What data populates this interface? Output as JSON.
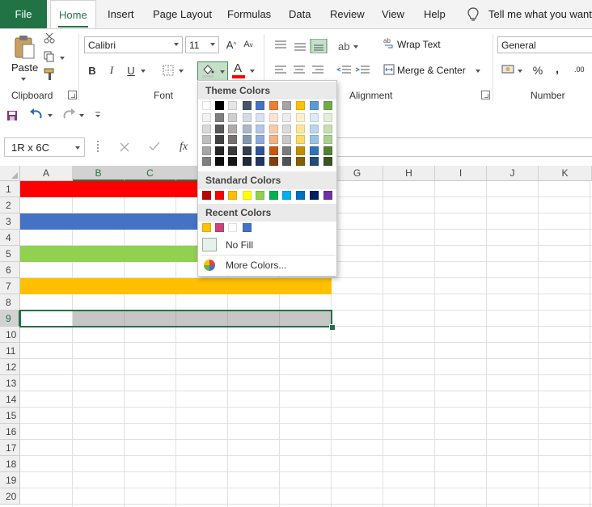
{
  "tabs": {
    "file": "File",
    "items": [
      "Home",
      "Insert",
      "Page Layout",
      "Formulas",
      "Data",
      "Review",
      "View",
      "Help"
    ],
    "tell_me": "Tell me what you want to do"
  },
  "clipboard": {
    "paste": "Paste",
    "label": "Clipboard"
  },
  "font": {
    "name": "Calibri",
    "size": "11",
    "label": "Font",
    "bold": "B",
    "italic": "I",
    "underline": "U"
  },
  "alignment": {
    "wrap": "Wrap Text",
    "merge": "Merge & Center",
    "label": "Alignment"
  },
  "number": {
    "format": "General",
    "label": "Number",
    "percent": "%",
    "comma": ",",
    "decimal": ".00"
  },
  "formula_bar": {
    "name_box": "1R x 6C",
    "fx": "fx",
    "value": ""
  },
  "columns": [
    "A",
    "B",
    "C",
    "D",
    "E",
    "F",
    "G",
    "H",
    "I",
    "J",
    "K"
  ],
  "rows": [
    "1",
    "2",
    "3",
    "4",
    "5",
    "6",
    "7",
    "8",
    "9",
    "10",
    "11",
    "12",
    "13",
    "14",
    "15",
    "16",
    "17",
    "18",
    "19",
    "20"
  ],
  "row_fills": [
    {
      "row": 1,
      "color": "#ff0000"
    },
    {
      "row": 3,
      "color": "#4472c4"
    },
    {
      "row": 5,
      "color": "#92d050"
    },
    {
      "row": 7,
      "color": "#ffc000"
    }
  ],
  "selection_fill": "#c6c6c6",
  "dropdown": {
    "theme_title": "Theme Colors",
    "standard_title": "Standard Colors",
    "recent_title": "Recent Colors",
    "no_fill": "No Fill",
    "more_colors": "More Colors...",
    "theme_colors": [
      [
        "#ffffff",
        "#f2f2f2",
        "#d9d9d9",
        "#bfbfbf",
        "#a6a6a6",
        "#808080"
      ],
      [
        "#000000",
        "#7f7f7f",
        "#595959",
        "#404040",
        "#262626",
        "#0d0d0d"
      ],
      [
        "#e7e6e6",
        "#d0cece",
        "#aeabab",
        "#757171",
        "#3a3838",
        "#171616"
      ],
      [
        "#44546a",
        "#d6dce4",
        "#adb9ca",
        "#8497b0",
        "#333f4f",
        "#222b35"
      ],
      [
        "#4472c4",
        "#d9e1f2",
        "#b4c6e7",
        "#8ea9db",
        "#305496",
        "#203764"
      ],
      [
        "#ed7d31",
        "#fce4d6",
        "#f8cbad",
        "#f4b084",
        "#c65911",
        "#833c0c"
      ],
      [
        "#a5a5a5",
        "#ededed",
        "#dbdbdb",
        "#c9c9c9",
        "#7b7b7b",
        "#525252"
      ],
      [
        "#ffc000",
        "#fff2cc",
        "#ffe699",
        "#ffd966",
        "#bf8f00",
        "#806000"
      ],
      [
        "#5b9bd5",
        "#ddebf7",
        "#bdd7ee",
        "#9bc2e6",
        "#2f75b5",
        "#1f4e78"
      ],
      [
        "#70ad47",
        "#e2efda",
        "#c6e0b4",
        "#a9d08e",
        "#548235",
        "#375623"
      ]
    ],
    "standard_colors": [
      "#c00000",
      "#ff0000",
      "#ffc000",
      "#ffff00",
      "#92d050",
      "#00b050",
      "#00b0f0",
      "#0070c0",
      "#002060",
      "#7030a0"
    ],
    "recent_colors": [
      "#ffc000",
      "#cc4477",
      "#ffffff",
      "#4472c4"
    ]
  }
}
